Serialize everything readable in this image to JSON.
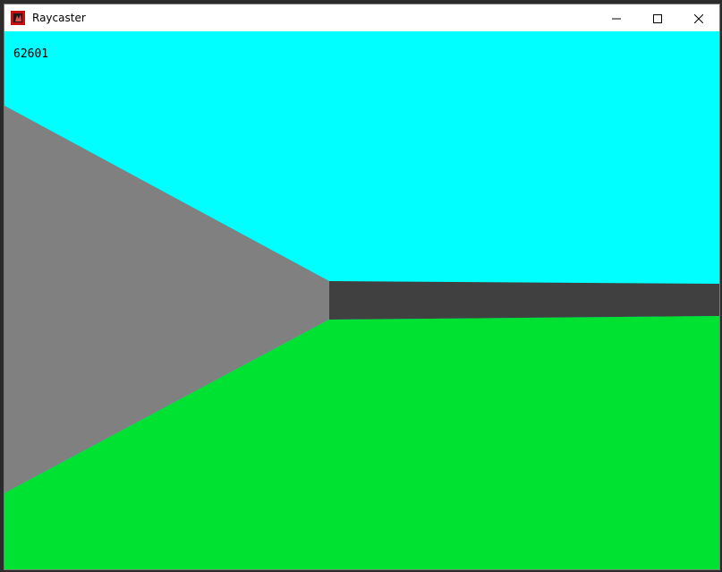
{
  "window": {
    "title": "Raycaster",
    "app_icon": "raycaster-app-icon"
  },
  "controls": {
    "minimize_icon": "minimize-icon",
    "maximize_icon": "maximize-icon",
    "close_icon": "close-icon"
  },
  "scene": {
    "counter_value": "62601",
    "colors": {
      "sky": "#00ffff",
      "floor": "#00e232",
      "left_wall": "#808080",
      "far_wall": "#404040"
    }
  }
}
